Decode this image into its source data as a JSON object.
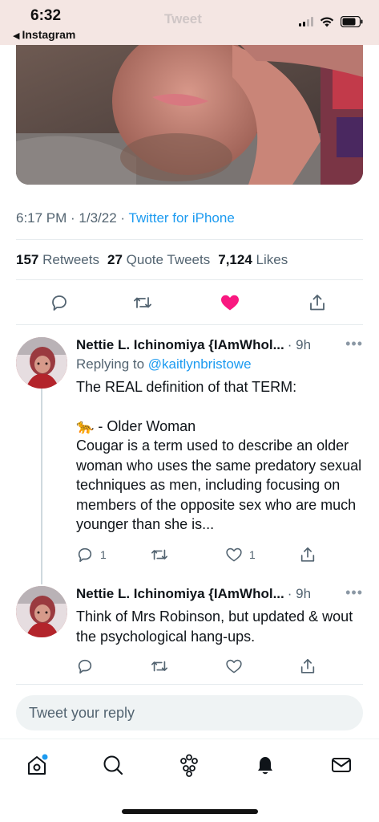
{
  "status_bar": {
    "time": "6:32",
    "back_label": "Instagram",
    "faded_title": "Tweet"
  },
  "tweet": {
    "time": "6:17 PM",
    "date": "1/3/22",
    "source": "Twitter for iPhone",
    "stats": {
      "retweets_count": "157",
      "retweets_label": "Retweets",
      "quotes_count": "27",
      "quotes_label": "Quote Tweets",
      "likes_count": "7,124",
      "likes_label": "Likes"
    },
    "liked_color": "#f91880"
  },
  "replies": [
    {
      "name": "Nettie L. Ichinomiya {IAmWhol...",
      "time": "· 9h",
      "replying_prefix": "Replying to ",
      "replying_handle": "@kaitlynbristowe",
      "line1": "The REAL definition of that TERM:",
      "emoji": "🐆",
      "line2": " - Older Woman",
      "line3": "Cougar is a term used to describe an older woman who uses the same predatory sexual techniques as men, including focusing on members of the opposite sex who are much younger than she is...",
      "reply_count": "1",
      "like_count": "1"
    },
    {
      "name": "Nettie L. Ichinomiya {IAmWhol...",
      "time": "· 9h",
      "text": "Think of Mrs Robinson, but updated & wout the psychological hang-ups."
    }
  ],
  "composer": {
    "placeholder": "Tweet your reply"
  },
  "colors": {
    "accent": "#1d9bf0",
    "muted": "#536471"
  }
}
